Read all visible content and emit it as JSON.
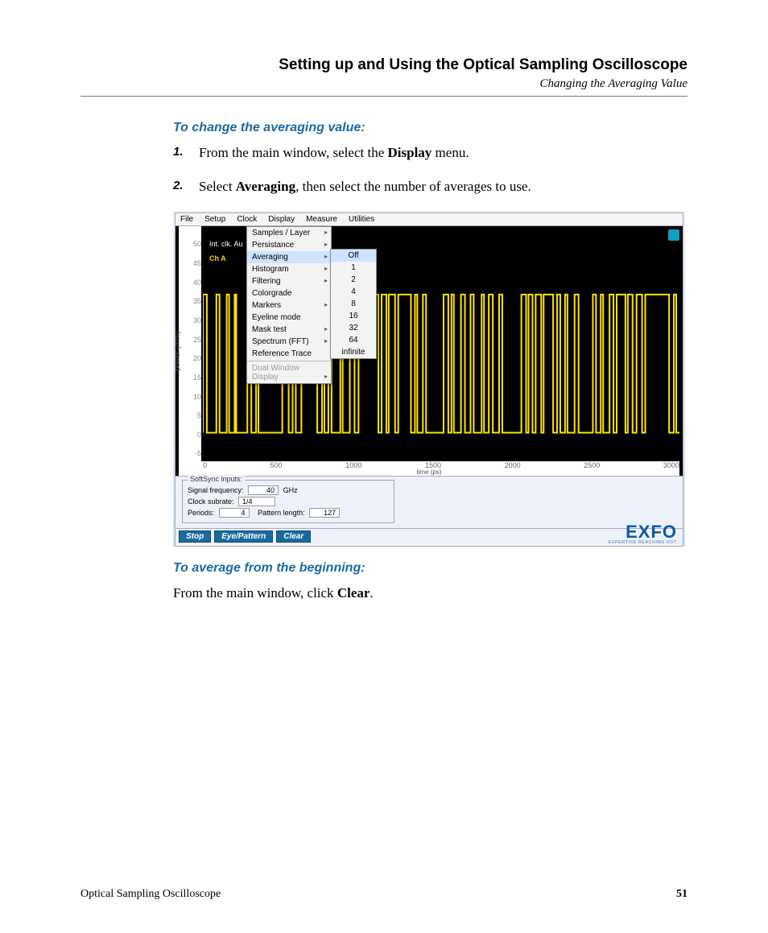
{
  "header": {
    "chapter": "Setting up and Using the Optical Sampling Oscilloscope",
    "section": "Changing the Averaging Value"
  },
  "task1": {
    "title": "To change the averaging value:",
    "steps": [
      {
        "num": "1.",
        "pre": "From the main window, select the ",
        "bold": "Display",
        "post": " menu."
      },
      {
        "num": "2.",
        "pre": "Select ",
        "bold": "Averaging",
        "post": ", then select the number of averages to use."
      }
    ]
  },
  "screenshot": {
    "menubar": [
      "File",
      "Setup",
      "Clock",
      "Display",
      "Measure",
      "Utilities"
    ],
    "overlay_labels": {
      "clk": "Int. clk. Au",
      "ch": "Ch A"
    },
    "display_menu": [
      {
        "label": "Samples / Layer",
        "arrow": true
      },
      {
        "label": "Persistance",
        "arrow": true
      },
      {
        "label": "Averaging",
        "arrow": true,
        "highlight": true
      },
      {
        "label": "Histogram",
        "arrow": true
      },
      {
        "label": "Filtering",
        "arrow": true
      },
      {
        "label": "Colorgrade"
      },
      {
        "label": "Markers",
        "arrow": true
      },
      {
        "label": "Eyeline mode"
      },
      {
        "label": "Mask test",
        "arrow": true
      },
      {
        "label": "Spectrum (FFT)",
        "arrow": true
      },
      {
        "label": "Reference Trace"
      },
      {
        "sep": true
      },
      {
        "label": "Dual Window Display",
        "arrow": true,
        "disabled": true
      }
    ],
    "averaging_submenu": [
      {
        "label": "Off",
        "highlight": true
      },
      {
        "label": "1"
      },
      {
        "label": "2"
      },
      {
        "label": "4"
      },
      {
        "label": "8"
      },
      {
        "label": "16"
      },
      {
        "label": "32"
      },
      {
        "label": "64"
      },
      {
        "label": "infinite"
      }
    ],
    "yaxis_label": "power (mW)",
    "xaxis_label": "time (ps)",
    "y_ticks": [
      "50",
      "45",
      "40",
      "35",
      "30",
      "25",
      "20",
      "15",
      "10",
      "5",
      "0",
      "-5"
    ],
    "x_ticks": [
      "0",
      "500",
      "1000",
      "1500",
      "2000",
      "2500",
      "3000"
    ],
    "softsync": {
      "legend": "SoftSync inputs:",
      "signal_freq_label": "Signal frequency:",
      "signal_freq_value": "40",
      "signal_freq_unit": "GHz",
      "clock_subrate_label": "Clock subrate:",
      "clock_subrate_value": "1/4",
      "periods_label": "Periods:",
      "periods_value": "4",
      "pattern_len_label": "Pattern length:",
      "pattern_len_value": "127"
    },
    "buttons": {
      "stop": "Stop",
      "eye": "Eye/Pattern",
      "clear": "Clear"
    },
    "brand": {
      "logo": "EXFO",
      "tagline": "EXPERTISE REACHING OUT"
    }
  },
  "task2": {
    "title": "To average from the beginning:",
    "body_pre": "From the main window, click ",
    "body_bold": "Clear",
    "body_post": "."
  },
  "footer": {
    "left": "Optical Sampling Oscilloscope",
    "right": "51"
  }
}
